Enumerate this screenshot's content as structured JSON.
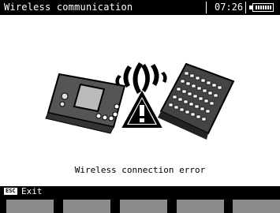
{
  "window": {
    "title": "Wireless communication",
    "time": "07:26"
  },
  "main": {
    "status_text": "Wireless connection error"
  },
  "bottom": {
    "esc_label": "ESC",
    "exit_label": "Exit"
  },
  "function_keys": [
    "",
    "",
    "",
    "",
    ""
  ],
  "icons": [
    "meter-device-icon",
    "signal-waves-icon",
    "warning-triangle-icon",
    "keyboard-device-icon",
    "battery-icon"
  ]
}
